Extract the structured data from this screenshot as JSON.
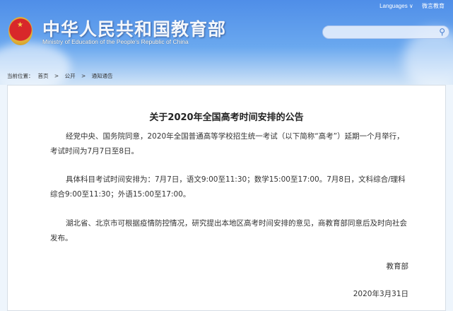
{
  "header": {
    "title": "中华人民共和国教育部",
    "subtitle": "Ministry of Education of the People's Republic of China",
    "languages": "Languages ∨",
    "weibo": "微言教育",
    "search_placeholder": ""
  },
  "breadcrumb": {
    "label": "当前位置：",
    "items": [
      "首页",
      "公开",
      "通知通告"
    ],
    "sep": ">"
  },
  "article": {
    "title": "关于2020年全国高考时间安排的公告",
    "paragraphs": [
      "经党中央、国务院同意，2020年全国普通高等学校招生统一考试（以下简称“高考”）延期一个月举行，考试时间为7月7日至8日。",
      "具体科目考试时间安排为：7月7日，语文9:00至11:30；数学15:00至17:00。7月8日，文科综合/理科综合9:00至11:30；外语15:00至17:00。",
      "湖北省、北京市可根据疫情防控情况，研究提出本地区高考时间安排的意见，商教育部同意后及时向社会发布。"
    ],
    "signature": "教育部",
    "date": "2020年3月31日"
  }
}
